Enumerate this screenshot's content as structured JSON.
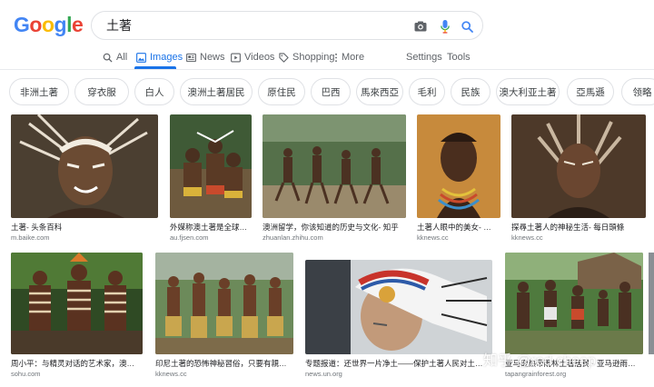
{
  "logo": {
    "letters": [
      "G",
      "o",
      "o",
      "g",
      "l",
      "e"
    ]
  },
  "search": {
    "query": "土著",
    "icons": [
      "camera-icon",
      "microphone-icon",
      "search-icon"
    ]
  },
  "tabs": [
    {
      "label": "All",
      "icon": "search-icon",
      "active": false
    },
    {
      "label": "Images",
      "icon": "image-icon",
      "active": true
    },
    {
      "label": "News",
      "icon": "news-icon",
      "active": false
    },
    {
      "label": "Videos",
      "icon": "play-icon",
      "active": false
    },
    {
      "label": "Shopping",
      "icon": "tag-icon",
      "active": false
    },
    {
      "label": "More",
      "icon": "more-vert-icon",
      "active": false
    }
  ],
  "tools": {
    "settings": "Settings",
    "tools": "Tools"
  },
  "chips": [
    "非洲土著",
    "穿衣服",
    "白人",
    "澳洲土著居民",
    "原住民",
    "巴西",
    "馬來西亞",
    "毛利",
    "民族",
    "澳大利亚土著",
    "亞馬遜",
    "领略"
  ],
  "results": [
    {
      "caption": "土著- 头条百科",
      "source": "m.baike.com"
    },
    {
      "caption": "外媒称澳土著是全球延...",
      "source": "au.fjsen.com"
    },
    {
      "caption": "澳洲留学，你该知道的历史与文化- 知乎",
      "source": "zhuanlan.zhihu.com"
    },
    {
      "caption": "土著人眼中的美女- 每日...",
      "source": "kknews.cc"
    },
    {
      "caption": "探尋土著人的神秘生活- 每日頭條",
      "source": "kknews.cc"
    },
    {
      "caption": "周小平：与精灵对话的艺术家，澳洲土...",
      "source": "sohu.com"
    },
    {
      "caption": "印尼土著的恐怖神秘習俗，只要有親人去...",
      "source": "kknews.cc"
    },
    {
      "caption": "专题报道：还世界一片净土——保护土著人民对土地、领土...",
      "source": "news.un.org"
    },
    {
      "caption": "亚马逊热带雨林土著居民 - 亚马逊雨林...",
      "source": "tapangrainforest.org"
    }
  ],
  "watermark": "知乎 @red cheep",
  "colors": {
    "accent": "#1a73e8",
    "chip_border": "#dfe1e5"
  }
}
